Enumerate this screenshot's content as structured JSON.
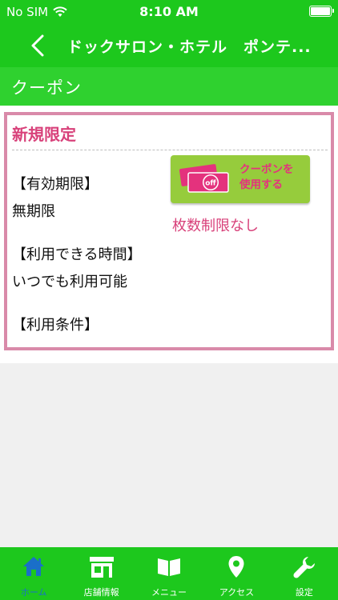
{
  "status_bar": {
    "carrier": "No SIM",
    "time": "8:10 AM"
  },
  "nav": {
    "title": "ドックサロン・ホテル　ポンテ..."
  },
  "sub_header": {
    "title": "クーポン"
  },
  "coupon": {
    "title": "新規限定",
    "expiry_label": "【有効期限】",
    "expiry_value": "無期限",
    "time_label": "【利用できる時間】",
    "time_value": "いつでも利用可能",
    "conditions_label": "【利用条件】",
    "use_button_line1": "クーポンを",
    "use_button_line2": "使用する",
    "use_button_tag": "off",
    "limit_text": "枚数制限なし"
  },
  "tabs": [
    {
      "label": "ホーム",
      "icon": "home-icon",
      "active": true
    },
    {
      "label": "店舗情報",
      "icon": "store-icon",
      "active": false
    },
    {
      "label": "メニュー",
      "icon": "book-icon",
      "active": false
    },
    {
      "label": "アクセス",
      "icon": "map-pin-icon",
      "active": false
    },
    {
      "label": "設定",
      "icon": "wrench-icon",
      "active": false
    }
  ],
  "colors": {
    "primary_green": "#1dc81d",
    "accent_pink": "#d8417a",
    "active_tab_blue": "#1a6fc9",
    "button_green": "#96cc3c"
  }
}
